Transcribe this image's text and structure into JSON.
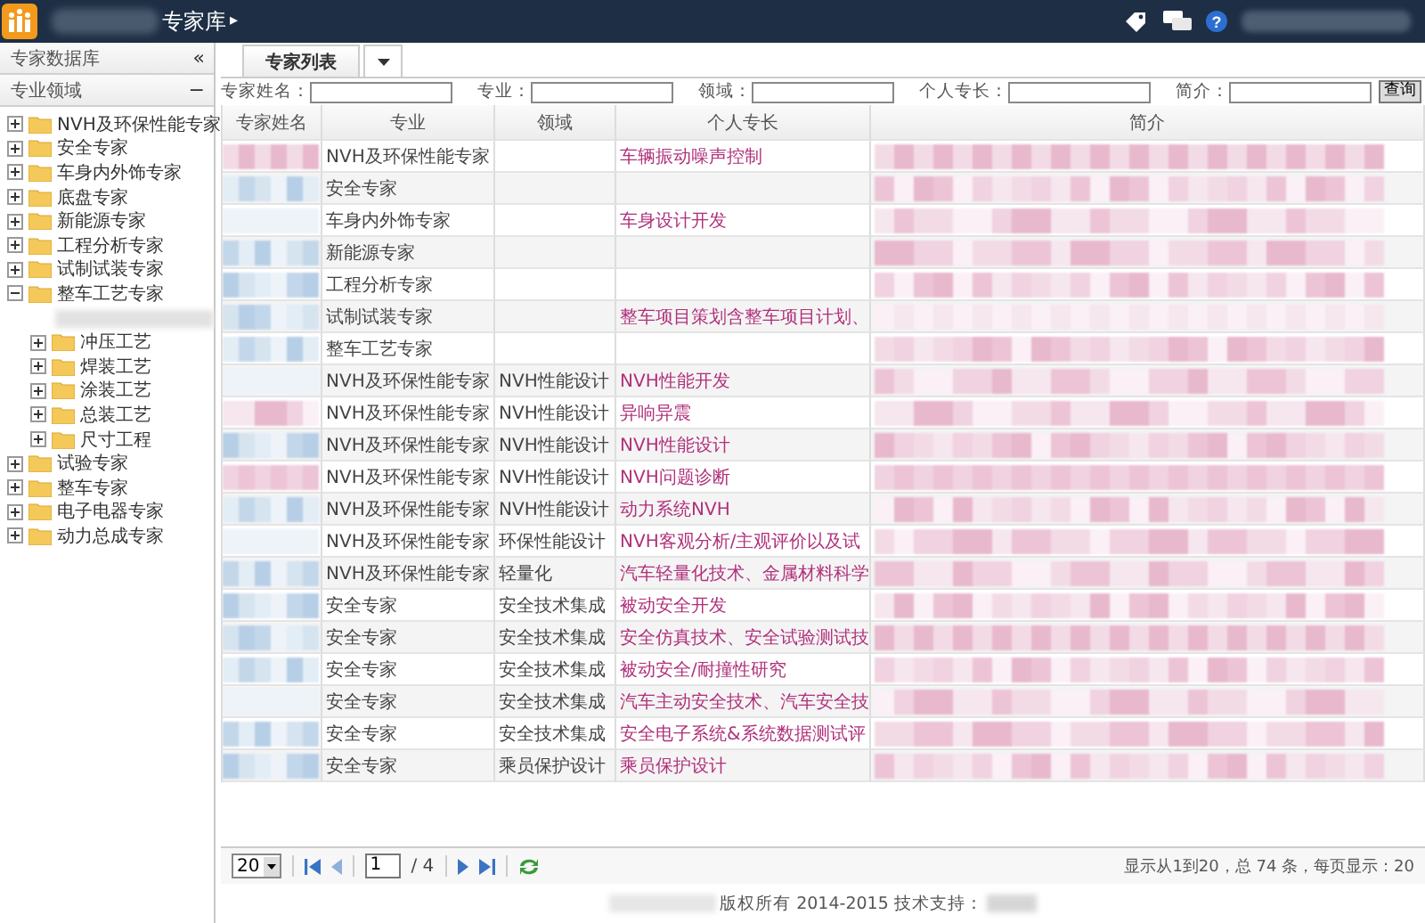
{
  "header": {
    "title": "专家库",
    "arrow": "▸",
    "help": "?"
  },
  "sidebar": {
    "title": "专家数据库",
    "collapse": "«",
    "section": "专业领域",
    "section_toggle": "−",
    "tree": [
      {
        "label": "NVH及环保性能专家",
        "expanded": false
      },
      {
        "label": "安全专家",
        "expanded": false
      },
      {
        "label": "车身内外饰专家",
        "expanded": false
      },
      {
        "label": "底盘专家",
        "expanded": false
      },
      {
        "label": "新能源专家",
        "expanded": false
      },
      {
        "label": "工程分析专家",
        "expanded": false
      },
      {
        "label": "试制试装专家",
        "expanded": false
      },
      {
        "label": "整车工艺专家",
        "expanded": true,
        "children": [
          {
            "redacted": true
          },
          {
            "label": "冲压工艺",
            "expanded": false
          },
          {
            "label": "焊装工艺",
            "expanded": false
          },
          {
            "label": "涂装工艺",
            "expanded": false
          },
          {
            "label": "总装工艺",
            "expanded": false
          },
          {
            "label": "尺寸工程",
            "expanded": false
          }
        ]
      },
      {
        "label": "试验专家",
        "expanded": false
      },
      {
        "label": "整车专家",
        "expanded": false
      },
      {
        "label": "电子电器专家",
        "expanded": false
      },
      {
        "label": "动力总成专家",
        "expanded": false
      }
    ]
  },
  "tabs": [
    {
      "label": "专家列表",
      "selected": true
    }
  ],
  "search": {
    "fields": [
      "专家姓名：",
      "专业：",
      "领域：",
      "个人专长：",
      "简介："
    ],
    "button": "查询"
  },
  "table": {
    "columns": [
      "专家姓名",
      "专业",
      "领域",
      "个人专长",
      "简介"
    ],
    "rows": [
      {
        "major": "NVH及环保性能专家",
        "field": "",
        "specialty": "车辆振动噪声控制"
      },
      {
        "major": "安全专家",
        "field": "",
        "specialty": ""
      },
      {
        "major": "车身内外饰专家",
        "field": "",
        "specialty": "车身设计开发"
      },
      {
        "major": "新能源专家",
        "field": "",
        "specialty": ""
      },
      {
        "major": "工程分析专家",
        "field": "",
        "specialty": ""
      },
      {
        "major": "试制试装专家",
        "field": "",
        "specialty": "整车项目策划含整车项目计划、"
      },
      {
        "major": "整车工艺专家",
        "field": "",
        "specialty": ""
      },
      {
        "major": "NVH及环保性能专家",
        "field": "NVH性能设计",
        "specialty": "NVH性能开发"
      },
      {
        "major": "NVH及环保性能专家",
        "field": "NVH性能设计",
        "specialty": "异响异震"
      },
      {
        "major": "NVH及环保性能专家",
        "field": "NVH性能设计",
        "specialty": "NVH性能设计"
      },
      {
        "major": "NVH及环保性能专家",
        "field": "NVH性能设计",
        "specialty": "NVH问题诊断"
      },
      {
        "major": "NVH及环保性能专家",
        "field": "NVH性能设计",
        "specialty": "动力系统NVH"
      },
      {
        "major": "NVH及环保性能专家",
        "field": "环保性能设计",
        "specialty": "NVH客观分析/主观评价以及试"
      },
      {
        "major": "NVH及环保性能专家",
        "field": "轻量化",
        "specialty": "汽车轻量化技术、金属材料科学"
      },
      {
        "major": "安全专家",
        "field": "安全技术集成",
        "specialty": "被动安全开发"
      },
      {
        "major": "安全专家",
        "field": "安全技术集成",
        "specialty": "安全仿真技术、安全试验测试技"
      },
      {
        "major": "安全专家",
        "field": "安全技术集成",
        "specialty": "被动安全/耐撞性研究"
      },
      {
        "major": "安全专家",
        "field": "安全技术集成",
        "specialty": "汽车主动安全技术、汽车安全技"
      },
      {
        "major": "安全专家",
        "field": "安全技术集成",
        "specialty": "安全电子系统&系统数据测试评"
      },
      {
        "major": "安全专家",
        "field": "乘员保护设计",
        "specialty": "乘员保护设计"
      }
    ]
  },
  "pager": {
    "page_size": "20",
    "page": "1",
    "total_pages": "/ 4",
    "status": "显示从1到20，总 74 条，每页显示：20"
  },
  "footer": "版权所有 2014-2015 技术支持："
}
